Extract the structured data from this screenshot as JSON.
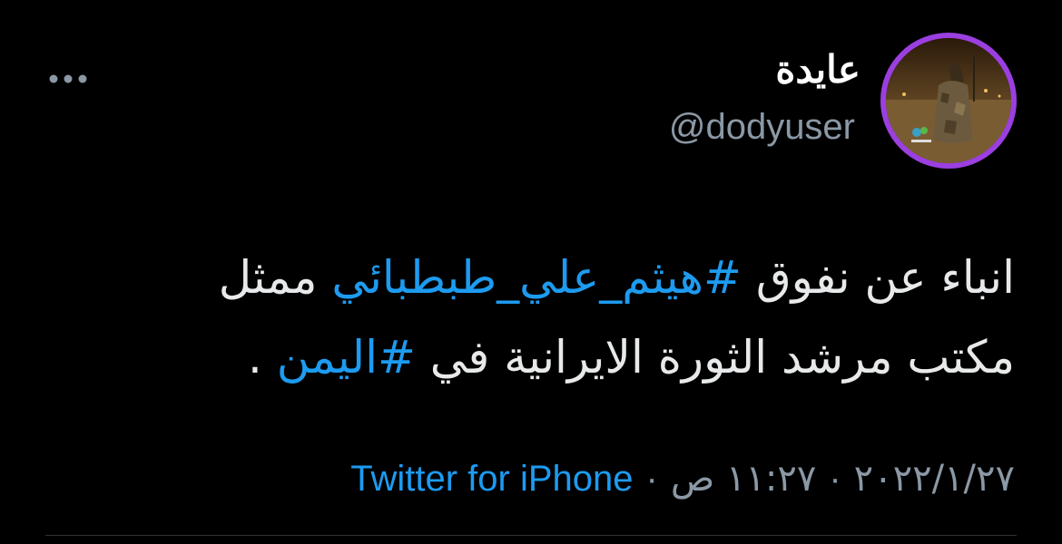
{
  "author": {
    "display_name": "عايدة",
    "username": "@dodyuser",
    "avatar_icon": "avatar-photo",
    "avatar_ring_color": "#9b3fe0"
  },
  "more_icon": "ellipsis-icon",
  "tweet": {
    "text_start": "انباء عن نفوق ",
    "hashtag1": "#هيثم_علي_طبطبائي",
    "text_middle": " ممثل مكتب مرشد الثورة الايرانية  في ",
    "hashtag2": "#اليمن",
    "text_end": " ."
  },
  "meta": {
    "date": "٢٠٢٢/١/٢٧",
    "separator": "·",
    "time": "١١:٢٧ ص",
    "source": "Twitter for iPhone"
  },
  "colors": {
    "background": "#000000",
    "text": "#e7e9ea",
    "secondary": "#8b98a5",
    "link": "#1d9bf0",
    "divider": "#2f3336"
  }
}
